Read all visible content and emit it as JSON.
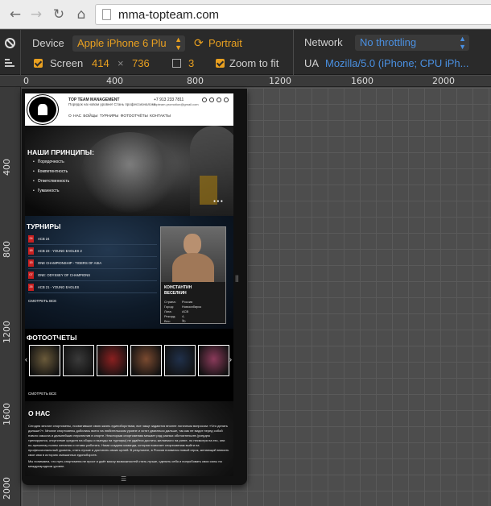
{
  "browser": {
    "back_icon": "arrow-left-icon",
    "forward_icon": "arrow-right-icon",
    "reload_icon": "reload-icon",
    "home_icon": "home-icon",
    "url": "mma-topteam.com"
  },
  "devtools": {
    "device_label": "Device",
    "device_value": "Apple iPhone 6 Plu",
    "orientation": "Portrait",
    "screen_label": "Screen",
    "width": "414",
    "times": "×",
    "height": "736",
    "dpr": "3",
    "zoom_label": "Zoom to fit",
    "network_label": "Network",
    "network_value": "No throttling",
    "ua_label": "UA",
    "ua_value": "Mozilla/5.0 (iPhone; CPU iPh...",
    "accent": "#e9a020",
    "link_blue": "#4a90e2"
  },
  "rulers": {
    "top": [
      "0",
      "400",
      "800",
      "1200",
      "1600",
      "2000"
    ],
    "left": [
      "400",
      "800",
      "1200",
      "1600",
      "2000"
    ]
  },
  "site": {
    "header": {
      "title": "TOP TEAM MANAGEMENT",
      "subtitle": "Порядок на новом уровне! Стань профессионалом!",
      "phone": "+7 913 233 7811",
      "email": "topteam.promotion@gmail.com",
      "nav": "О НАС  БОЙЦЫ  ТУРНИРЫ  ФОТООТЧЁТЫ  КОНТАКТЫ"
    },
    "principles": {
      "title": "НАШИ ПРИНЦИПЫ:",
      "items": [
        "Порядочность",
        "Компетентность",
        "Ответственность",
        "Гуманность"
      ],
      "dots": "● ● ●"
    },
    "tournaments": {
      "title": "ТУРНИРЫ",
      "items": [
        {
          "date": "24",
          "name": "ACB 24"
        },
        {
          "date": "18",
          "name": "ACB 23 - YOUNG EAGLES 2"
        },
        {
          "date": "15",
          "name": "ONE CHAMPIONSHIP - TIGERS OF ASIA"
        },
        {
          "date": "07",
          "name": "ONE: ODYSSEY OF CHAMPIONS"
        },
        {
          "date": "26",
          "name": "ACB 21 - YOUNG EAGLES"
        }
      ],
      "see_all": "СМОТРЕТЬ ВСЕ"
    },
    "fighter": {
      "name_line1": "КОНСТАНТИН",
      "name_line2": "ВЕСЕЛКИН",
      "rows": [
        {
          "label": "Страна:",
          "value": "Россия"
        },
        {
          "label": "Город:",
          "value": "Новосибирск"
        },
        {
          "label": "Лига:",
          "value": "ACB"
        },
        {
          "label": "Рекорд:",
          "value": "4-1"
        },
        {
          "label": "Вес:",
          "value": "70"
        }
      ]
    },
    "photos": {
      "title": "ФОТООТЧЕТЫ",
      "see_all": "СМОТРЕТЬ ВСЕ",
      "thumb_colors": [
        "#6a5a3a",
        "#3a3a3a",
        "#8a2020",
        "#7a4a30",
        "#20304a",
        "#8a3a5a"
      ]
    },
    "about": {
      "title": "О НАС",
      "text1": "Сегодня многие спортсмены, посвятившие свою жизнь единоборствам, все чаще задаются вполне логичным вопросом: «Что делать дальше?». Многие спортсмены добились всего на любительском уровне и хотят двигаться дальше, так как не видят перед собой нового смысла и дальнейших перспектив в спорте. Некоторым спортсменам мешает ряд разных обстоятельств (усердно тренируются, отсутствие средств на сборы и выезды на турниры) не удаётся достичь желаемого на ринге, но несмотря на это, они по-прежнему полны желания и готовы работать. Нами создана команда, которая помогает спортсменам выйти на профессиональный уровень, стать лучше и достигать своих целей. В результате, в России появился новый игрок, желающий вписать свое имя в историю смешанных единоборств.",
      "text2": "Мы понимаем, что путь спортсмена не прост и даёт массу возможностей стать лучше, сделать себя и попробовать свои силы на международном уровне."
    }
  }
}
